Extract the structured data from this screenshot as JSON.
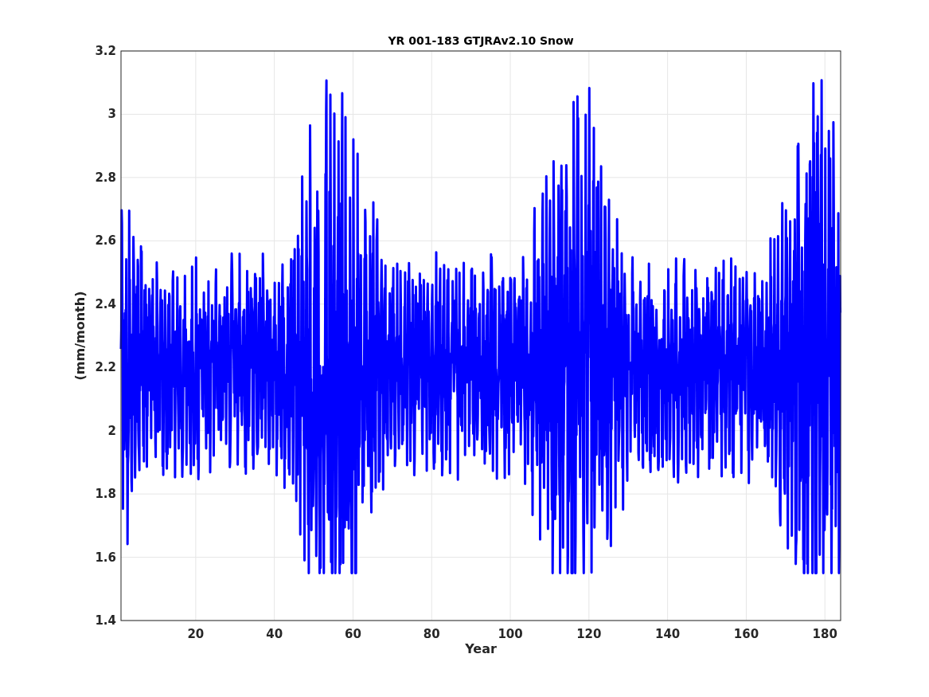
{
  "figure": {
    "title": "YR 001-183 GTJRAv2.10 Snow",
    "xlabel": "Year",
    "ylabel": "(mm/month)",
    "xticks": [
      "20",
      "40",
      "60",
      "80",
      "100",
      "120",
      "140",
      "160",
      "180"
    ],
    "yticks": [
      "3.2",
      "3",
      "2.8",
      "2.6",
      "2.4",
      "2.2",
      "2",
      "1.8",
      "1.6",
      "1.4"
    ]
  }
}
